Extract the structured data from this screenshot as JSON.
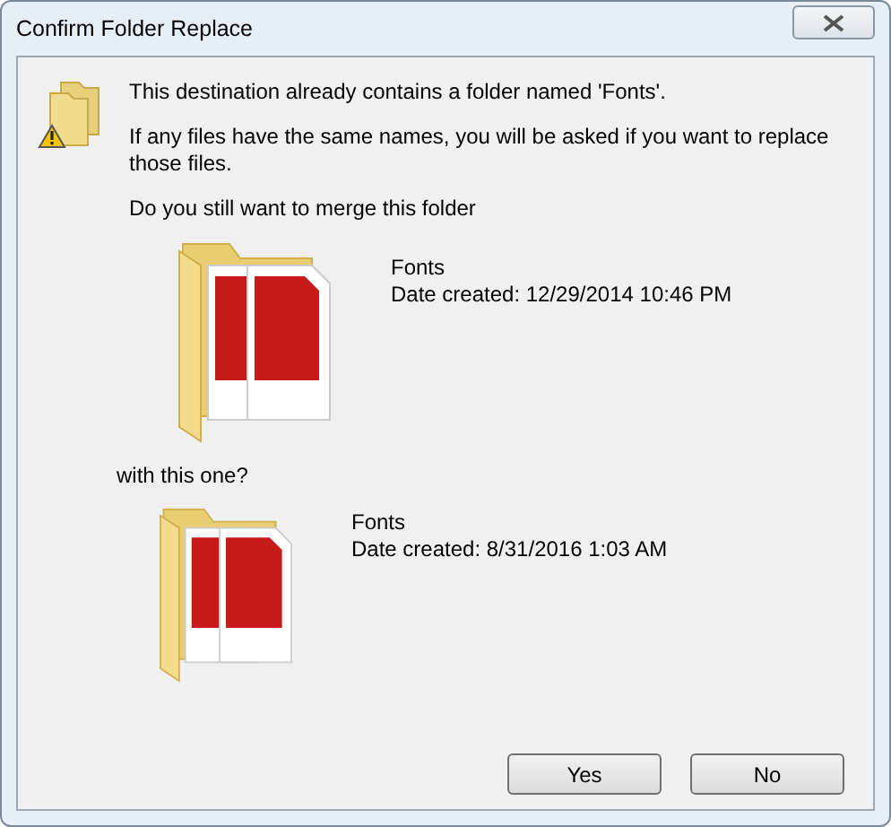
{
  "window": {
    "title": "Confirm Folder Replace"
  },
  "messages": [
    "This destination already contains a folder named 'Fonts'.",
    "If any files have the same names, you will be asked if you want to replace those files.",
    "Do you still want to merge this folder"
  ],
  "existing_folder": {
    "name": "Fonts",
    "date": "Date created: 12/29/2014 10:46 PM"
  },
  "connector": "with this one?",
  "incoming_folder": {
    "name": "Fonts",
    "date": "Date created: 8/31/2016 1:03 AM"
  },
  "buttons": [
    {
      "label": "Yes"
    },
    {
      "label": "No"
    }
  ]
}
